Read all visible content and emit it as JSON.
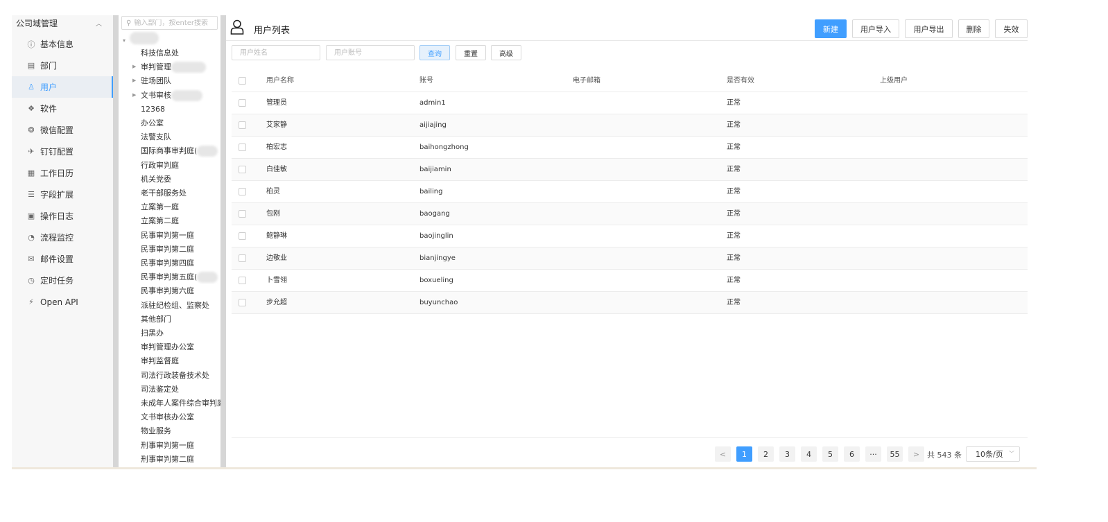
{
  "nav": {
    "header": "公司域管理",
    "items": [
      {
        "label": "基本信息",
        "icon": "info-circle-icon"
      },
      {
        "label": "部门",
        "icon": "building-icon"
      },
      {
        "label": "用户",
        "icon": "user-icon",
        "active": true
      },
      {
        "label": "软件",
        "icon": "apps-icon"
      },
      {
        "label": "微信配置",
        "icon": "wechat-icon"
      },
      {
        "label": "钉钉配置",
        "icon": "dingtalk-icon"
      },
      {
        "label": "工作日历",
        "icon": "calendar-icon"
      },
      {
        "label": "字段扩展",
        "icon": "sliders-icon"
      },
      {
        "label": "操作日志",
        "icon": "log-icon"
      },
      {
        "label": "流程监控",
        "icon": "dashboard-icon"
      },
      {
        "label": "邮件设置",
        "icon": "mail-icon"
      },
      {
        "label": "定时任务",
        "icon": "clock-icon"
      },
      {
        "label": "Open API",
        "icon": "plug-icon"
      }
    ]
  },
  "tree": {
    "search_placeholder": "输入部门，按enter搜索",
    "nodes": [
      {
        "label": "科技信息处",
        "expandable": false
      },
      {
        "label": "审判管理",
        "expandable": true
      },
      {
        "label": "驻场团队",
        "expandable": true
      },
      {
        "label": "文书审核",
        "expandable": true
      },
      {
        "label": "12368",
        "expandable": false
      },
      {
        "label": "办公室",
        "expandable": false
      },
      {
        "label": "法警支队",
        "expandable": false
      },
      {
        "label": "国际商事审判庭(",
        "expandable": false
      },
      {
        "label": "行政审判庭",
        "expandable": false
      },
      {
        "label": "机关党委",
        "expandable": false
      },
      {
        "label": "老干部服务处",
        "expandable": false
      },
      {
        "label": "立案第一庭",
        "expandable": false
      },
      {
        "label": "立案第二庭",
        "expandable": false
      },
      {
        "label": "民事审判第一庭",
        "expandable": false
      },
      {
        "label": "民事审判第二庭",
        "expandable": false
      },
      {
        "label": "民事审判第四庭",
        "expandable": false
      },
      {
        "label": "民事审判第五庭(",
        "expandable": false
      },
      {
        "label": "民事审判第六庭",
        "expandable": false
      },
      {
        "label": "派驻纪检组、监察处",
        "expandable": false
      },
      {
        "label": "其他部门",
        "expandable": false
      },
      {
        "label": "扫黑办",
        "expandable": false
      },
      {
        "label": "审判管理办公室",
        "expandable": false
      },
      {
        "label": "审判监督庭",
        "expandable": false
      },
      {
        "label": "司法行政装备技术处",
        "expandable": false
      },
      {
        "label": "司法鉴定处",
        "expandable": false
      },
      {
        "label": "未成年人案件综合审判庭",
        "expandable": false
      },
      {
        "label": "文书审核办公室",
        "expandable": false
      },
      {
        "label": "物业服务",
        "expandable": false
      },
      {
        "label": "刑事审判第一庭",
        "expandable": false
      },
      {
        "label": "刑事审判第二庭",
        "expandable": false
      }
    ]
  },
  "main": {
    "title": "用户列表",
    "toolbar": {
      "new": "新建",
      "import": "用户导入",
      "export": "用户导出",
      "delete": "删除",
      "disable": "失效"
    },
    "filters": {
      "name_placeholder": "用户姓名",
      "account_placeholder": "用户账号",
      "query": "查询",
      "reset": "重置",
      "advanced": "高级"
    },
    "table": {
      "columns": [
        "用户名称",
        "账号",
        "电子邮箱",
        "是否有效",
        "上级用户"
      ],
      "rows": [
        {
          "name": "管理员",
          "account": "admin1",
          "email": "",
          "status": "正常",
          "superior": ""
        },
        {
          "name": "艾家静",
          "account": "aijiajing",
          "email": "",
          "status": "正常",
          "superior": ""
        },
        {
          "name": "柏宏志",
          "account": "baihongzhong",
          "email": "",
          "status": "正常",
          "superior": ""
        },
        {
          "name": "白佳敏",
          "account": "baijiamin",
          "email": "",
          "status": "正常",
          "superior": ""
        },
        {
          "name": "柏灵",
          "account": "bailing",
          "email": "",
          "status": "正常",
          "superior": ""
        },
        {
          "name": "包刚",
          "account": "baogang",
          "email": "",
          "status": "正常",
          "superior": ""
        },
        {
          "name": "鲍静琳",
          "account": "baojinglin",
          "email": "",
          "status": "正常",
          "superior": ""
        },
        {
          "name": "边敬业",
          "account": "bianjingye",
          "email": "",
          "status": "正常",
          "superior": ""
        },
        {
          "name": "卜雪翎",
          "account": "boxueling",
          "email": "",
          "status": "正常",
          "superior": ""
        },
        {
          "name": "步允超",
          "account": "buyunchao",
          "email": "",
          "status": "正常",
          "superior": ""
        }
      ]
    },
    "pagination": {
      "pages": [
        "1",
        "2",
        "3",
        "4",
        "5",
        "6",
        "···",
        "55"
      ],
      "current": "1",
      "prev": "<",
      "next": ">",
      "total": "共 543 条",
      "page_size": "10条/页"
    }
  },
  "colors": {
    "accent": "#409eff",
    "nav_bg": "#f7f7f7",
    "active_bg": "#eaeef3"
  }
}
